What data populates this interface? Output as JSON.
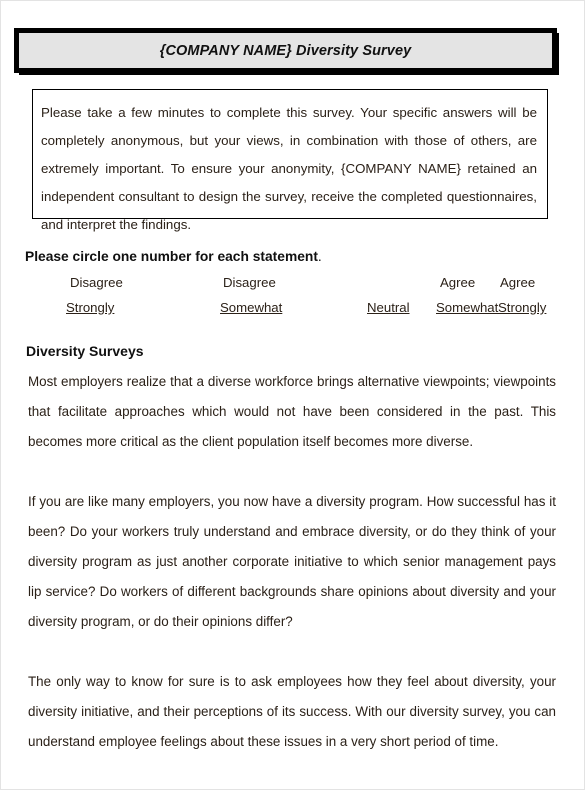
{
  "document": {
    "title": "{COMPANY NAME} Diversity Survey",
    "intro": "Please take a few minutes to complete this survey.  Your specific answers will be completely anonymous, but your views, in combination with those of others, are extremely important.  To ensure your anonymity, {COMPANY NAME} retained an independent consultant to design the survey, receive the completed questionnaires, and interpret the findings.",
    "instruction": "Please circle one number for each statement",
    "instruction_period": ".",
    "scale": {
      "columns": [
        {
          "top": "Disagree",
          "bottom": "Strongly"
        },
        {
          "top": "Disagree",
          "bottom": "Somewhat"
        },
        {
          "top": "",
          "bottom": "Neutral"
        },
        {
          "top": "Agree",
          "bottom": "Somewhat"
        },
        {
          "top": "Agree",
          "bottom": "Strongly"
        }
      ]
    },
    "section_heading": "Diversity Surveys",
    "paragraphs": [
      "Most employers realize that a diverse workforce brings alternative viewpoints; viewpoints that facilitate approaches which would not have been considered in the past. This becomes more critical as the client population itself becomes more diverse.",
      "If you are like many employers, you now have a diversity program. How successful has it been? Do your workers truly understand and embrace diversity, or do they think of your diversity program as just another corporate initiative to which senior management pays lip service? Do workers of different backgrounds share opinions about diversity and your diversity program, or do their opinions differ?",
      "The only way to know for sure is to ask employees how they feel about diversity, your diversity initiative, and their perceptions of its success. With our diversity survey, you can understand employee feelings about these issues in a very short period of time."
    ],
    "colors": {
      "banner_background": "#e4e4e4",
      "banner_border": "#000000",
      "body_text": "#2b2118",
      "page_background": "#ffffff"
    }
  }
}
